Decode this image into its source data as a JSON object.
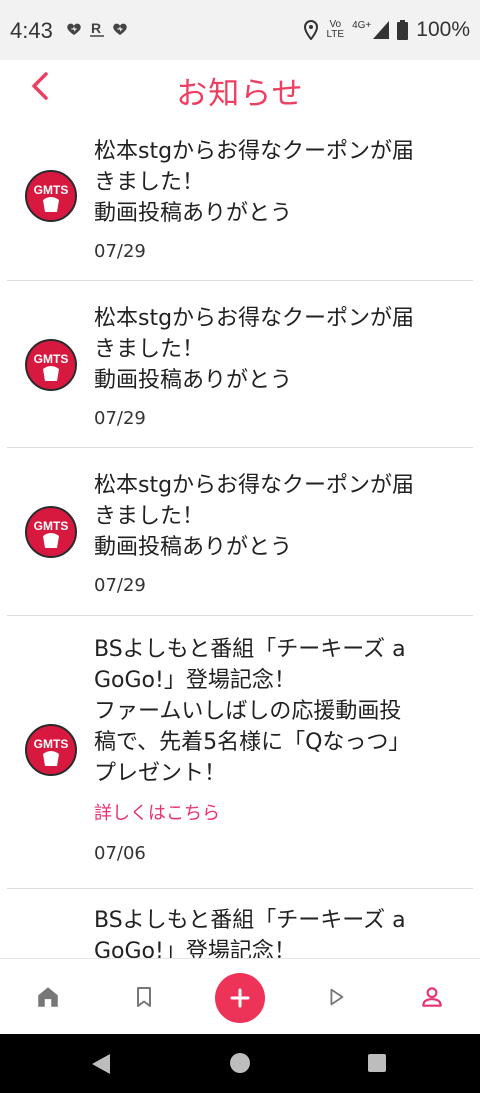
{
  "status_bar": {
    "time": "4:43",
    "battery": "100%",
    "network": "4G+",
    "volte_top": "Vo",
    "volte_bottom": "LTE"
  },
  "header": {
    "title": "お知らせ"
  },
  "notifications": [
    {
      "lines": [
        "松本stgからお得なクーポンが届",
        "きました！",
        "動画投稿ありがとう"
      ],
      "date": "07/29"
    },
    {
      "lines": [
        "松本stgからお得なクーポンが届",
        "きました！",
        "動画投稿ありがとう"
      ],
      "date": "07/29"
    },
    {
      "lines": [
        "松本stgからお得なクーポンが届",
        "きました！",
        "動画投稿ありがとう"
      ],
      "date": "07/29"
    },
    {
      "lines": [
        "BSよしもと番組「チーキーズ a",
        "GoGo!」登場記念！",
        "ファームいしばしの応援動画投",
        "稿で、先着5名様に「Qなっつ」",
        "プレゼント！"
      ],
      "link": "詳しくはこちら",
      "date": "07/06"
    },
    {
      "lines": [
        "BSよしもと番組「チーキーズ a",
        "GoGo!」登場記念！"
      ]
    }
  ],
  "avatar_text": "GMTS",
  "bottom_nav": [
    "home-icon",
    "bookmark-icon",
    "add-icon",
    "play-icon",
    "person-icon"
  ],
  "colors": {
    "accent": "#ee3f62",
    "link": "#e8336e",
    "active_nav": "#e8336e"
  }
}
